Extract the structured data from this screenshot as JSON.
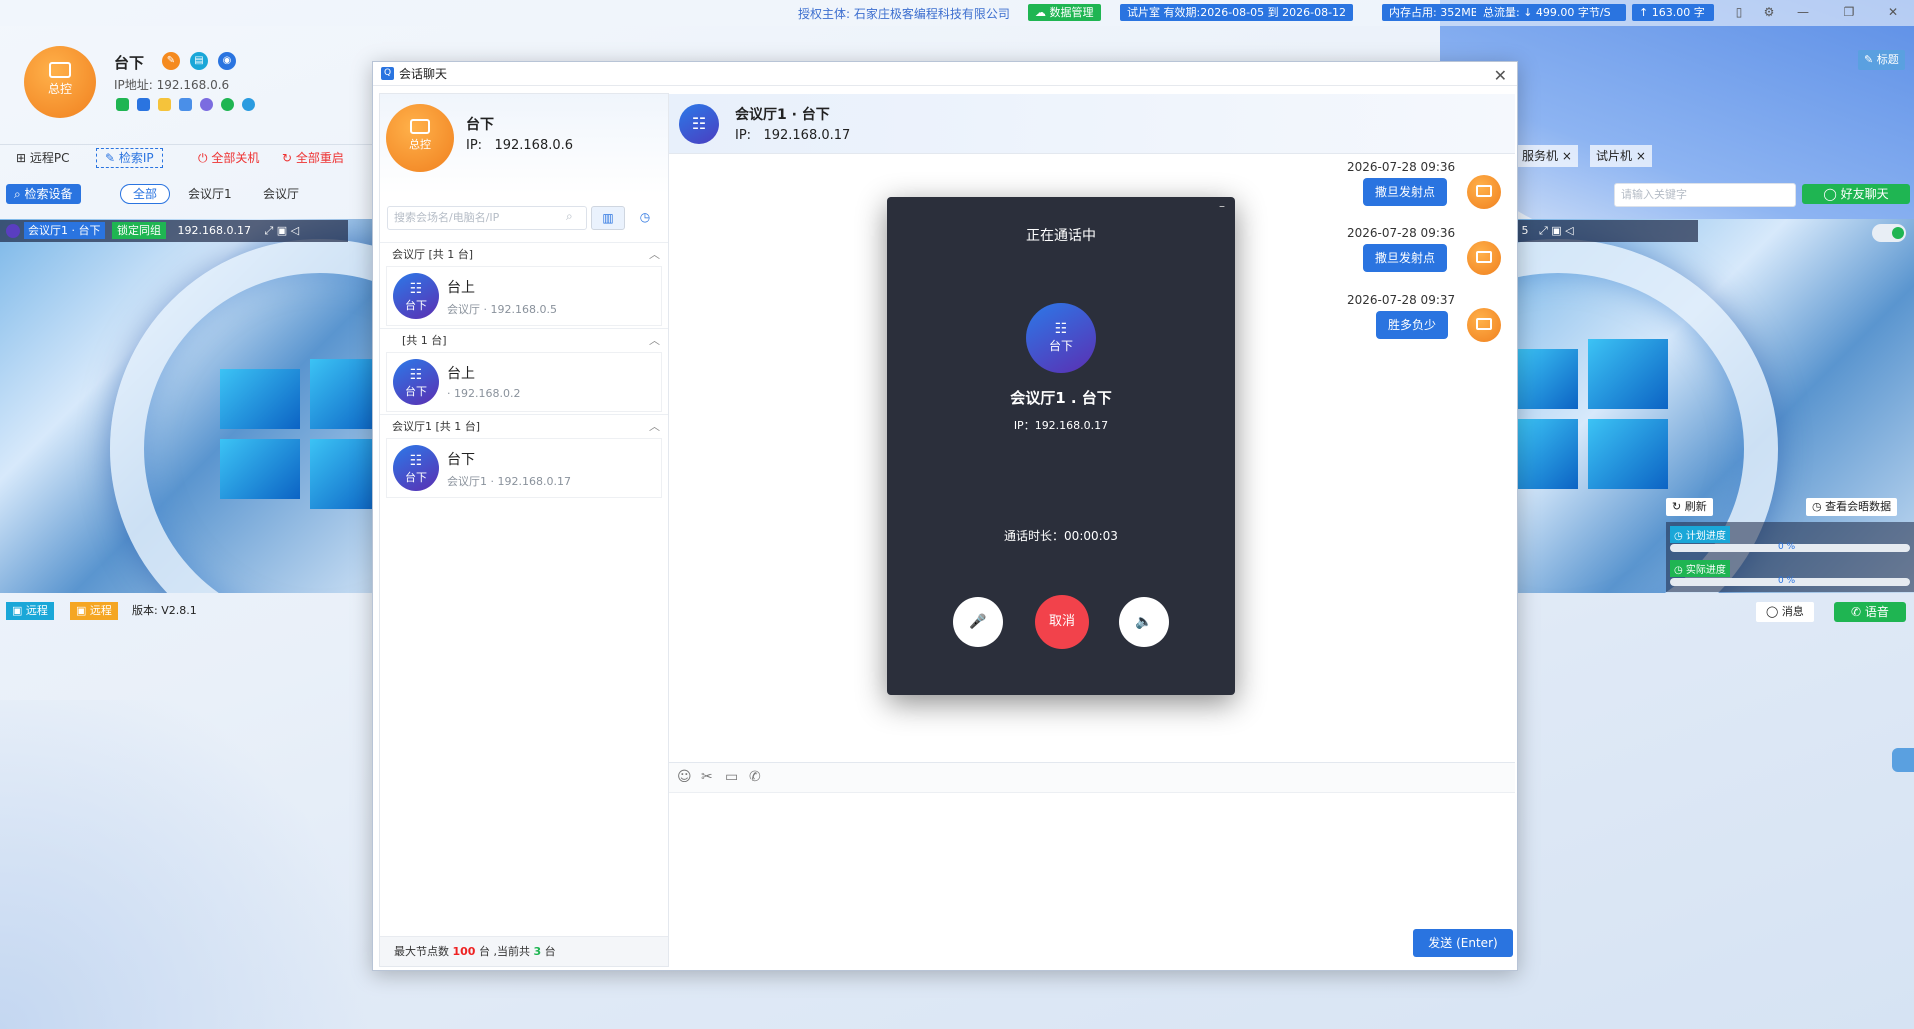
{
  "topbar": {
    "license": "授权主体: 石家庄极客编程科技有限公司",
    "data_mgmt": "数据管理",
    "trial": "试片室 有效期:2026-08-05 到 2026-08-12",
    "memory": "内存占用: 352MB",
    "traffic": "总流量: ↓ 499.00 字节/S",
    "upload": "↑ 163.00 字",
    "btn_title": "标题"
  },
  "profile": {
    "avatar_label": "总控",
    "name": "台下",
    "ip": "IP地址: 192.168.0.6"
  },
  "toolbar": {
    "remote_pc": "远程PC",
    "search_ip": "检索IP",
    "shutdown_all": "全部关机",
    "restart_all": "全部重启",
    "search_device": "检索设备",
    "filter_all": "全部",
    "filter_room1": "会议厅1",
    "filter_room": "会议厅"
  },
  "preview_left": {
    "title": "会议厅1 · 台下",
    "lock": "锁定同组",
    "ip": "192.168.0.17"
  },
  "bottom_left": {
    "remote1": "远程",
    "remote2": "远程",
    "version": "版本: V2.8.1"
  },
  "right_panel": {
    "tab_server": "服务机",
    "tab_trial": "试片机",
    "search_placeholder": "请输入关键字",
    "friend_chat": "好友聊天",
    "refresh": "刷新",
    "view_data": "查看会晤数据",
    "plan_progress": "计划进度",
    "plan_pct": "0 %",
    "actual_progress": "实际进度",
    "actual_pct": "0 %",
    "message": "消息",
    "voice": "语音"
  },
  "dialog": {
    "title": "会话聊天",
    "me": {
      "avatar_label": "总控",
      "name": "台下",
      "ip": "IP:   192.168.0.6"
    },
    "search_placeholder": "搜索会场名/电脑名/IP",
    "groups": [
      {
        "title": "会议厅   [共 1 台]",
        "item": {
          "avatar": "台下",
          "name": "台上",
          "sub": "会议厅 · 192.168.0.5"
        }
      },
      {
        "title": "[共 1 台]",
        "item": {
          "avatar": "台下",
          "name": "台上",
          "sub": " · 192.168.0.2"
        }
      },
      {
        "title": "会议厅1   [共 1 台]",
        "item": {
          "avatar": "台下",
          "name": "台下",
          "sub": "会议厅1 · 192.168.0.17"
        }
      }
    ],
    "footer_pre": "最大节点数 ",
    "footer_max": "100",
    "footer_mid": " 台 ,当前共 ",
    "footer_cur": "3",
    "footer_post": " 台",
    "chat_head": {
      "name": "会议厅1 · 台下",
      "ip": "IP:   192.168.0.17"
    },
    "messages": [
      {
        "time": "2026-07-28 09:36",
        "text": "撒旦发射点"
      },
      {
        "time": "2026-07-28 09:36",
        "text": "撒旦发射点"
      },
      {
        "time": "2026-07-28 09:37",
        "text": "胜多负少"
      }
    ],
    "send": "发送 (Enter)"
  },
  "call": {
    "status": "正在通话中",
    "avatar_label": "台下",
    "name": "会议厅1 . 台下",
    "ip": "IP：192.168.0.17",
    "duration": "通话时长：00:00:03",
    "cancel": "取消"
  }
}
